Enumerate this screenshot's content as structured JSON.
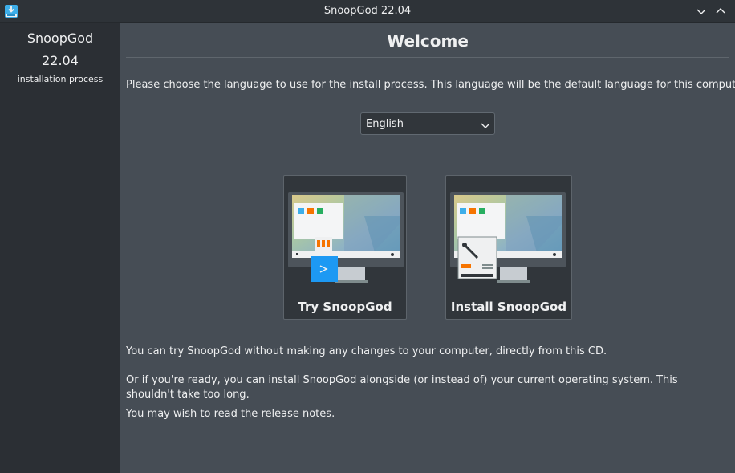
{
  "window": {
    "title": "SnoopGod 22.04",
    "icon": "installer-download-icon",
    "minimize_icon": "chevron-down-icon",
    "maximize_icon": "chevron-up-icon"
  },
  "sidebar": {
    "name": "SnoopGod",
    "version": "22.04",
    "subtitle": "installation process"
  },
  "main": {
    "heading": "Welcome",
    "intro": "Please choose the language to use for the install process. This language will be the default language for this computer.",
    "language": {
      "selected": "English"
    },
    "choices": [
      {
        "label": "Try SnoopGod",
        "icon": "usb-drive-icon"
      },
      {
        "label": "Install SnoopGod",
        "icon": "hard-drive-install-icon"
      }
    ],
    "para_try": "You can try SnoopGod without making any changes to your computer, directly from this CD.",
    "para_install": "Or if you're ready, you can install SnoopGod alongside (or instead of) your current operating system.  This shouldn't take too long.",
    "para_notes_prefix": "You may wish to read the ",
    "para_notes_link": "release notes",
    "para_notes_suffix": "."
  },
  "colors": {
    "sidebar_bg": "#2b2f34",
    "main_bg": "#464d55",
    "card_bg": "#31363b",
    "accent": "#1d99f3"
  }
}
